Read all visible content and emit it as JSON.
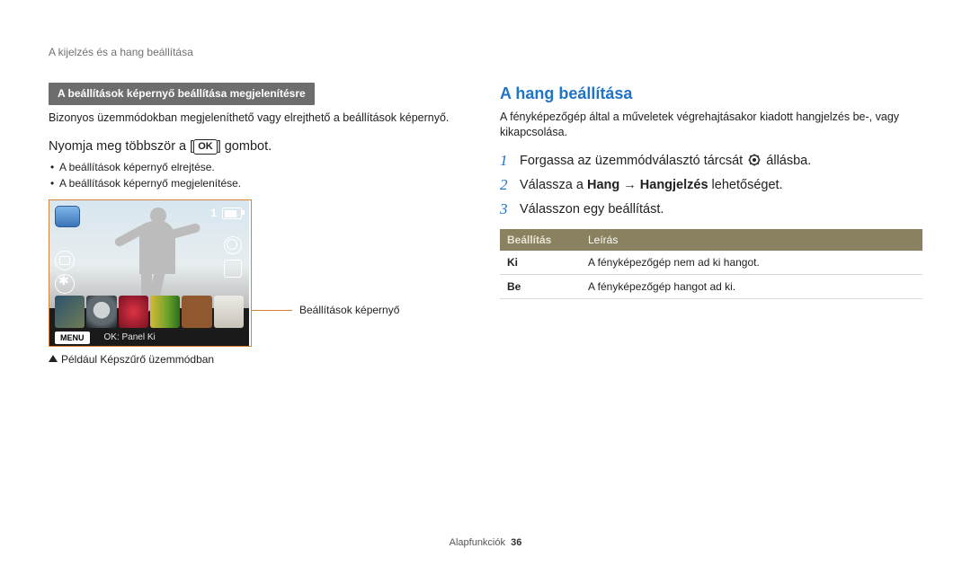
{
  "header": "A kijelzés és a hang beállítása",
  "left": {
    "pill": "A beállítások képernyő beállítása megjelenítésre",
    "intro": "Bizonyos üzemmódokban megjeleníthető vagy elrejthető a beállítások képernyő.",
    "press_pre": "Nyomja meg többször a [",
    "press_ok": "OK",
    "press_post": "] gombot.",
    "bullets": [
      "A beállítások képernyő elrejtése.",
      "A beállítások képernyő megjelenítése."
    ],
    "shot": {
      "counter": "1",
      "menu": "MENU",
      "okpanel": "OK: Panel Ki",
      "callout": "Beállítások képernyő"
    },
    "caption": "Például Képszűrő üzemmódban"
  },
  "right": {
    "title": "A hang beállítása",
    "intro": "A fényképezőgép által a műveletek végrehajtásakor kiadott hangjelzés be-, vagy kikapcsolása.",
    "steps": [
      {
        "n": "1",
        "pre": "Forgassa az üzemmódválasztó tárcsát ",
        "post": " állásba."
      },
      {
        "n": "2",
        "pre": "Válassza a ",
        "b1": "Hang",
        "arrow": " → ",
        "b2": "Hangjelzés",
        "post": " lehetőséget."
      },
      {
        "n": "3",
        "pre": "Válasszon egy beállítást."
      }
    ],
    "table": {
      "h1": "Beállítás",
      "h2": "Leírás",
      "rows": [
        {
          "k": "Ki",
          "v": "A fényképezőgép nem ad ki hangot."
        },
        {
          "k": "Be",
          "v": "A fényképezőgép hangot ad ki."
        }
      ]
    }
  },
  "footer": {
    "label": "Alapfunkciók",
    "page": "36"
  }
}
